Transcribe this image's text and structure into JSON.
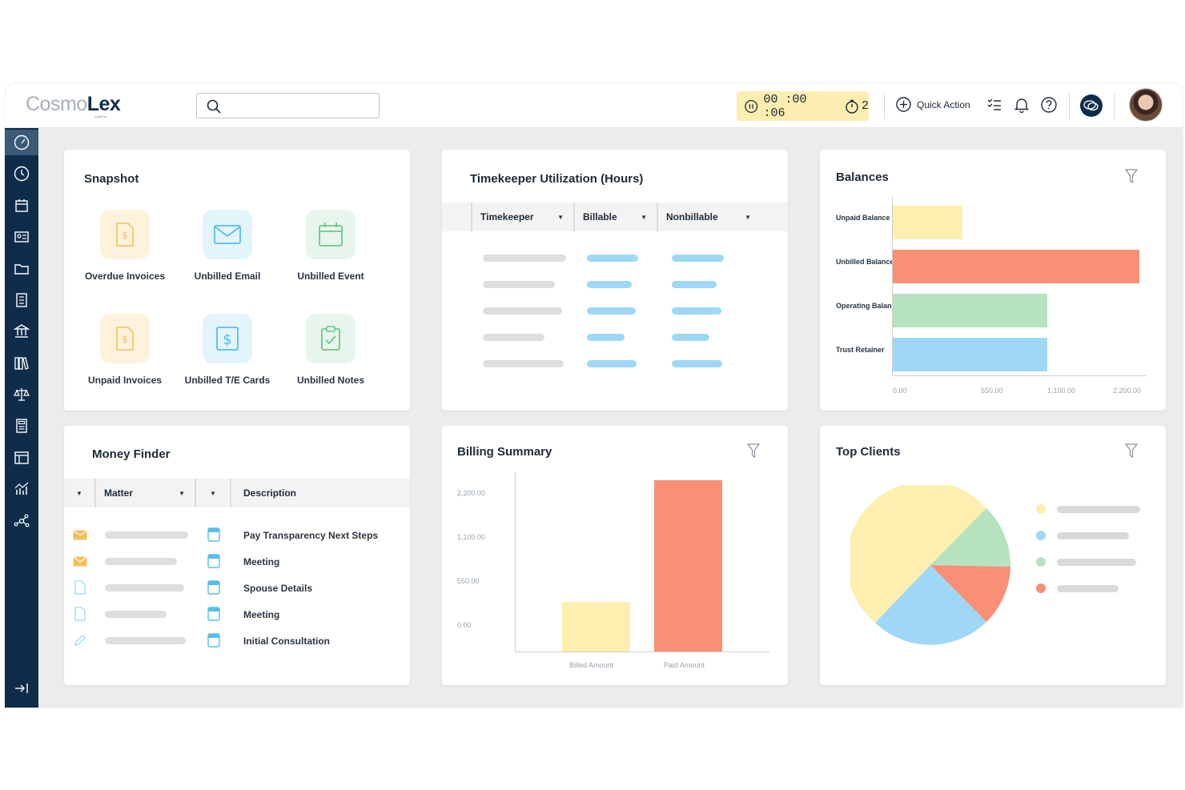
{
  "header": {
    "logo_left": "Cosmo",
    "logo_right": "Lex",
    "logo_sub": "by AffiniPay",
    "search_placeholder": "",
    "timer": "00 :00 :06",
    "timer_count": "2",
    "quick_action": "Quick Action"
  },
  "sidebar": {
    "items": [
      "dashboard-icon",
      "clock-icon",
      "calendar-icon",
      "contact-card-icon",
      "folder-icon",
      "document-icon",
      "bank-icon",
      "library-icon",
      "scales-icon",
      "calculator-icon",
      "layout-icon",
      "analytics-icon",
      "network-icon"
    ],
    "collapse_icon": "collapse-icon"
  },
  "snapshot": {
    "title": "Snapshot",
    "items": [
      {
        "label": "Overdue Invoices",
        "icon": "invoice-icon",
        "color": "#fdf3dc"
      },
      {
        "label": "Unbilled Email",
        "icon": "email-icon",
        "color": "#e3f4fb"
      },
      {
        "label": "Unbilled Event",
        "icon": "calendar-icon",
        "color": "#e8f5ec"
      },
      {
        "label": "Unpaid Invoices",
        "icon": "invoice-icon",
        "color": "#fdf3dc"
      },
      {
        "label": "Unbilled T/E Cards",
        "icon": "dollar-card-icon",
        "color": "#e3f4fb"
      },
      {
        "label": "Unbilled Notes",
        "icon": "clipboard-check-icon",
        "color": "#e8f5ec"
      }
    ]
  },
  "timekeeper": {
    "title": "Timekeeper Utilization (Hours)",
    "columns": [
      "Timekeeper",
      "Billable",
      "Nonbillable"
    ]
  },
  "balances": {
    "title": "Balances",
    "categories": [
      "Unpaid Balance",
      "Unbilled Balance",
      "Operating Balance",
      "Trust Retainer"
    ],
    "ticks": [
      "0.00",
      "550.00",
      "1,100.00",
      "2,200.00"
    ],
    "colors": [
      "#fcefb0",
      "#f98f76",
      "#b6e2c0",
      "#9fd8f7"
    ]
  },
  "money_finder": {
    "title": "Money Finder",
    "columns": [
      "Matter",
      "Description"
    ],
    "rows": [
      {
        "icon": "email-icon",
        "description": "Pay Transparency Next Steps"
      },
      {
        "icon": "email-icon",
        "description": "Meeting"
      },
      {
        "icon": "document-icon",
        "description": "Spouse Details"
      },
      {
        "icon": "document-icon",
        "description": "Meeting"
      },
      {
        "icon": "pencil-icon",
        "description": "Initial Consultation"
      }
    ]
  },
  "billing": {
    "title": "Billing Summary",
    "ticks": [
      "2,200.00",
      "1,100.00",
      "550.00",
      "0.00"
    ],
    "categories": [
      "Billed Amount",
      "Paid Amount"
    ],
    "colors": [
      "#fcefb0",
      "#f98f76"
    ]
  },
  "top_clients": {
    "title": "Top Clients",
    "colors": [
      "#fcefb0",
      "#9fd8f7",
      "#b6e2c0",
      "#f98f76"
    ]
  }
}
